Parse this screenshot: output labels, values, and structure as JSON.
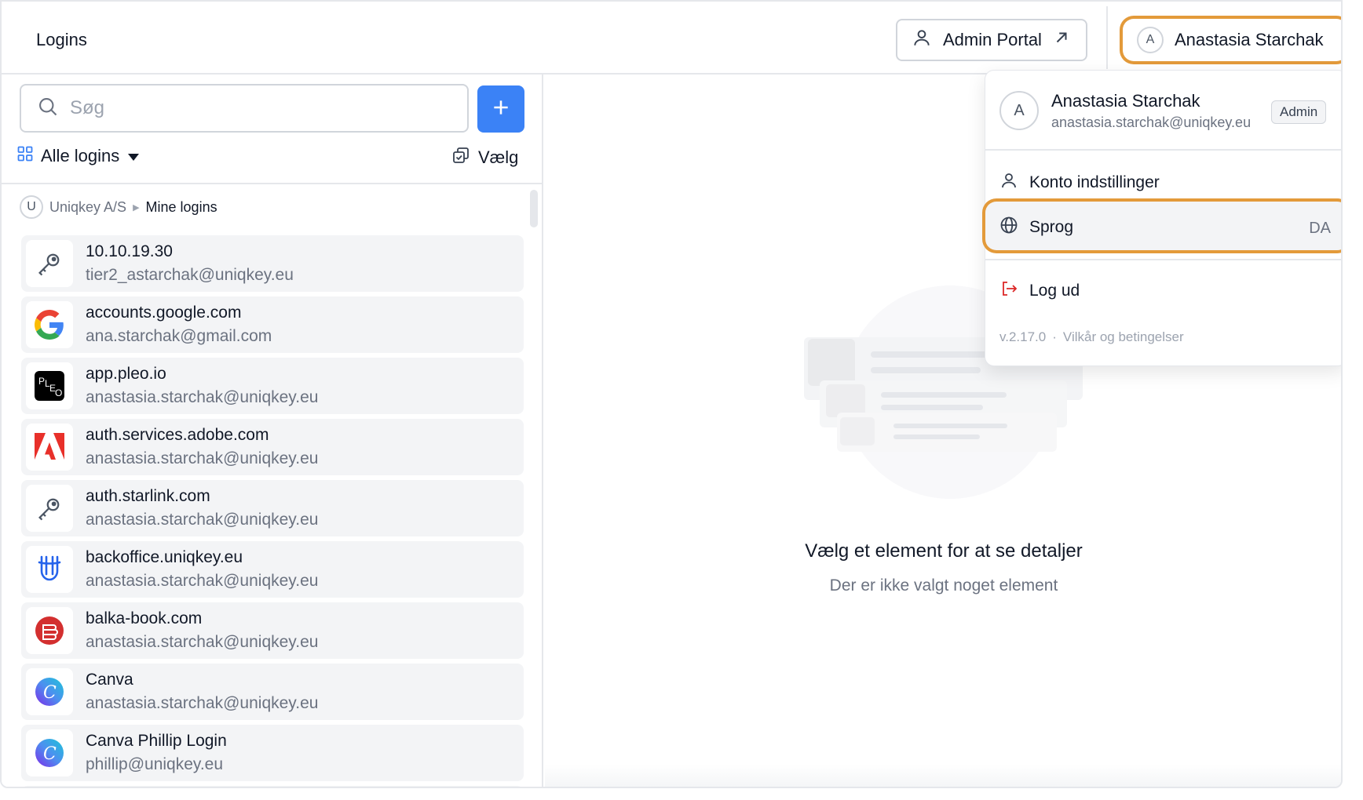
{
  "header": {
    "title": "Logins",
    "admin_portal_label": "Admin Portal",
    "user_initial": "A",
    "user_name": "Anastasia Starchak"
  },
  "sidebar": {
    "search_placeholder": "Søg",
    "filter_label": "Alle logins",
    "select_label": "Vælg",
    "breadcrumb": {
      "org_initial": "U",
      "org": "Uniqkey A/S",
      "current": "Mine logins"
    },
    "items": [
      {
        "name": "10.10.19.30",
        "user": "tier2_astarchak@uniqkey.eu",
        "icon": "key-icon"
      },
      {
        "name": "accounts.google.com",
        "user": "ana.starchak@gmail.com",
        "icon": "google-icon"
      },
      {
        "name": "app.pleo.io",
        "user": "anastasia.starchak@uniqkey.eu",
        "icon": "pleo-icon"
      },
      {
        "name": "auth.services.adobe.com",
        "user": "anastasia.starchak@uniqkey.eu",
        "icon": "adobe-icon"
      },
      {
        "name": "auth.starlink.com",
        "user": "anastasia.starchak@uniqkey.eu",
        "icon": "key-icon"
      },
      {
        "name": "backoffice.uniqkey.eu",
        "user": "anastasia.starchak@uniqkey.eu",
        "icon": "uniqkey-icon"
      },
      {
        "name": "balka-book.com",
        "user": "anastasia.starchak@uniqkey.eu",
        "icon": "balka-book-icon"
      },
      {
        "name": "Canva",
        "user": "anastasia.starchak@uniqkey.eu",
        "icon": "canva-icon"
      },
      {
        "name": "Canva Phillip Login",
        "user": "phillip@uniqkey.eu",
        "icon": "canva-icon"
      }
    ]
  },
  "empty_state": {
    "title": "Vælg et element for at se detaljer",
    "subtitle": "Der er ikke valgt noget element"
  },
  "user_menu": {
    "initial": "A",
    "name": "Anastasia Starchak",
    "email": "anastasia.starchak@uniqkey.eu",
    "role_badge": "Admin",
    "account_settings_label": "Konto indstillinger",
    "language_label": "Sprog",
    "language_value": "DA",
    "logout_label": "Log ud",
    "version": "v.2.17.0",
    "separator": "·",
    "terms_label": "Vilkår og betingelser"
  },
  "colors": {
    "accent": "#3b82f6",
    "highlight": "#e39a3a",
    "logout": "#dc2626"
  }
}
